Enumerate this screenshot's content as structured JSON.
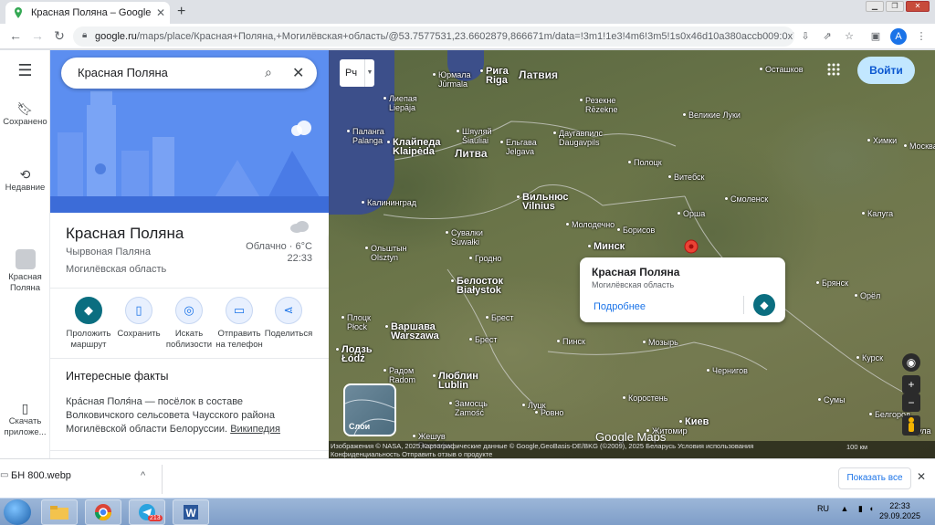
{
  "browser": {
    "tab_title": "Красная Поляна – Google Карты",
    "tab_close": "✕",
    "new_tab": "+",
    "url_host": "google.ru",
    "url_rest": "/maps/place/Красная+Поляна,+Могилёвская+область/@53.7577531,23.6602879,866671m/data=!3m1!1e3!4m6!3m5!1s0x46d10a380accb009:0x7a593...",
    "profile_initial": "A"
  },
  "rail": {
    "menu_icon": "menu-icon",
    "items": [
      {
        "label": "Сохранено",
        "icon": "bookmark-icon"
      },
      {
        "label": "Недавние",
        "icon": "history-icon"
      },
      {
        "label": "Красная Поляна",
        "icon": "place-thumbnail-icon"
      },
      {
        "label": "Скачать приложе...",
        "icon": "phone-icon"
      }
    ]
  },
  "panel": {
    "search_value": "Красная Поляна",
    "place_name": "Красная Поляна",
    "alt_name": "Чырвоная Паляна",
    "region": "Могилёвская область",
    "weather": "Облачно · 6°C",
    "weather_time": "22:33",
    "actions": [
      {
        "label": "Проложить маршрут",
        "icon": "directions-icon"
      },
      {
        "label": "Сохранить",
        "icon": "bookmark-icon"
      },
      {
        "label": "Искать поблизости",
        "icon": "nearby-icon"
      },
      {
        "label": "Отправить на телефон",
        "icon": "send-to-phone-icon"
      },
      {
        "label": "Поделиться",
        "icon": "share-icon"
      }
    ],
    "facts_title": "Интересные факты",
    "facts_text": "Кра́сная Поля́на — посёлок в составе Волковичского сельсовета Чаусского района Могилёвской области Белоруссии.",
    "facts_link": "Википедия"
  },
  "map": {
    "lang_button": "Рч",
    "signin": "Войти",
    "layers_label": "Слои",
    "logo": "Google Maps",
    "attribution": "Изображения © NASA, 2025,Картографические данные © Google,GeoBasis-DE/BKG (©2009), 2025   Беларусь   Условия использования",
    "attribution2": "Конфиденциальность   Отправить отзыв о продукте",
    "scale": "100 км",
    "infocard": {
      "title": "Красная Поляна",
      "subtitle": "Могилёвская область",
      "more": "Подробнее"
    },
    "countries": [
      {
        "name": "Латвия"
      },
      {
        "name": "Литва"
      }
    ],
    "cities": [
      {
        "name": "Рига\nRiga",
        "big": true
      },
      {
        "name": "Юрмала\nJūrmala"
      },
      {
        "name": "Лиепая\nLiepāja"
      },
      {
        "name": "Паланга\nPalanga"
      },
      {
        "name": "Клайпеда\nKlaipėda",
        "big": true
      },
      {
        "name": "Шяуляй\nŠiauliai"
      },
      {
        "name": "Даугавпилс\nDaugavpils"
      },
      {
        "name": "Резекне\nRēzekne"
      },
      {
        "name": "Вильнюс\nVilnius",
        "big": true
      },
      {
        "name": "Минск",
        "big": true
      },
      {
        "name": "Калининград"
      },
      {
        "name": "Сувалки\nSuwałki"
      },
      {
        "name": "Гродно"
      },
      {
        "name": "Белосток\nBiałystok",
        "big": true
      },
      {
        "name": "Варшава\nWarszawa",
        "big": true
      },
      {
        "name": "Лодзь\nŁódź",
        "big": true
      },
      {
        "name": "Люблин\nLublin",
        "big": true
      },
      {
        "name": "Брест"
      },
      {
        "name": "Молодечно"
      },
      {
        "name": "Борисов"
      },
      {
        "name": "Полоцк"
      },
      {
        "name": "Витебск"
      },
      {
        "name": "Орша"
      },
      {
        "name": "Смоленск"
      },
      {
        "name": "Великие Луки"
      },
      {
        "name": "Осташков"
      },
      {
        "name": "Химки"
      },
      {
        "name": "Москва"
      },
      {
        "name": "Калуга"
      },
      {
        "name": "Брянск"
      },
      {
        "name": "Орёл"
      },
      {
        "name": "Курск"
      },
      {
        "name": "Сумы"
      },
      {
        "name": "Чернигов"
      },
      {
        "name": "Киев",
        "big": true
      },
      {
        "name": "Мозырь"
      },
      {
        "name": "Житомир"
      },
      {
        "name": "Коростень"
      },
      {
        "name": "Пинск"
      },
      {
        "name": "Ровно"
      },
      {
        "name": "Луцк"
      },
      {
        "name": "Замосць\nZamość"
      },
      {
        "name": "Радом\nRadom"
      },
      {
        "name": "Плоцк\nPłock"
      },
      {
        "name": "Ольштын\nOlsztyn"
      },
      {
        "name": "Ельгава\nJelgava"
      },
      {
        "name": "Белгород"
      },
      {
        "name": "Тула"
      },
      {
        "name": "Брест"
      },
      {
        "name": "Жешув\nRzeszów"
      }
    ]
  },
  "download": {
    "filename": "БН 800.webp",
    "caret": "^",
    "show_all": "Показать все",
    "close": "✕"
  },
  "taskbar": {
    "lang": "RU",
    "time": "22:33",
    "date": "29.09.2025",
    "telegram_badge": "213"
  }
}
